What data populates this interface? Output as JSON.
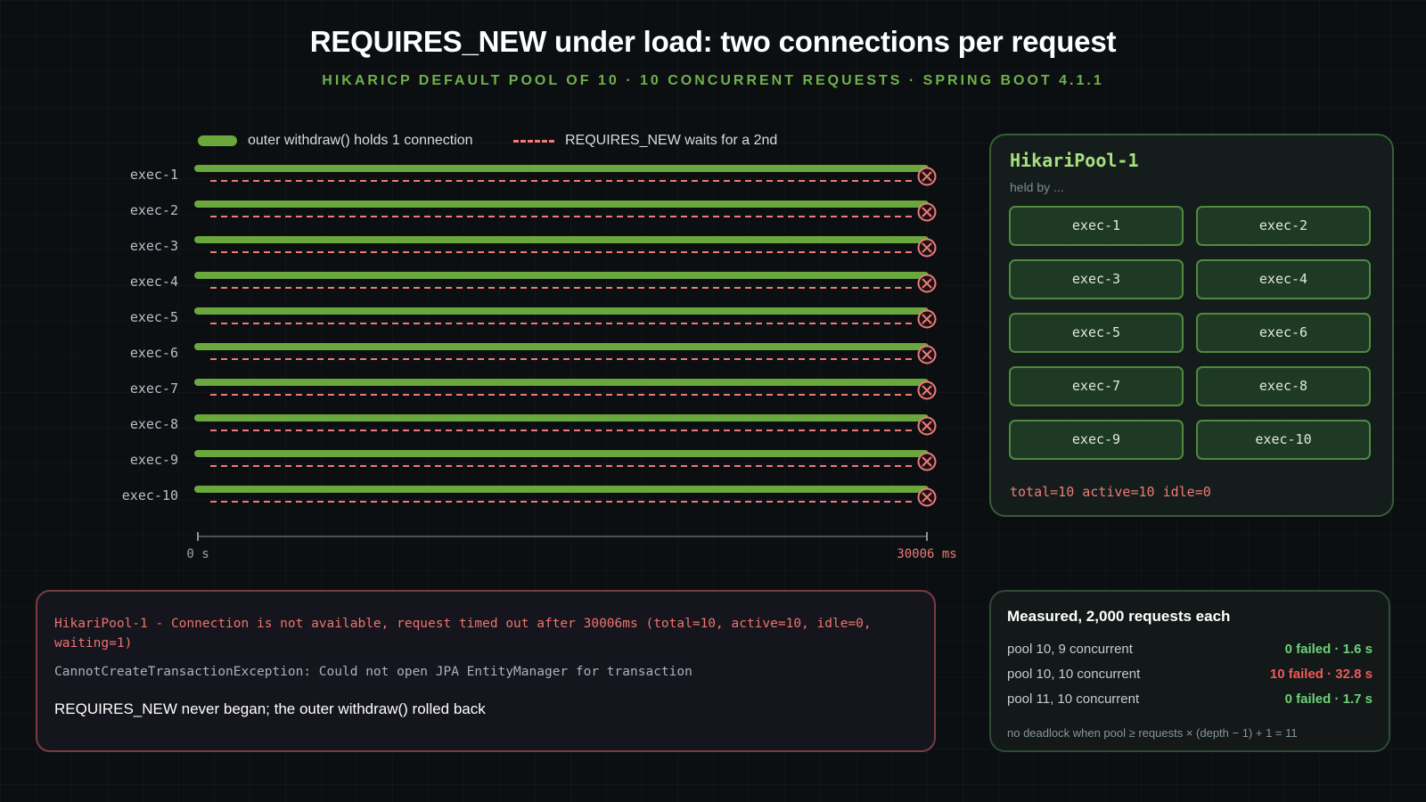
{
  "title": "REQUIRES_NEW under load: two connections per request",
  "subtitle": "HIKARICP DEFAULT POOL OF 10 · 10 CONCURRENT REQUESTS · SPRING BOOT 4.1.1",
  "legend": {
    "outer": "outer withdraw() holds 1 connection",
    "inner": "REQUIRES_NEW waits for a 2nd"
  },
  "timeline": {
    "rows": [
      "exec-1",
      "exec-2",
      "exec-3",
      "exec-4",
      "exec-5",
      "exec-6",
      "exec-7",
      "exec-8",
      "exec-9",
      "exec-10"
    ],
    "axis_start": "0 s",
    "axis_end": "30006 ms",
    "outcome_icon": "x-circle-icon"
  },
  "pool": {
    "name": "HikariPool-1",
    "held_by": "held by ...",
    "slots": [
      "exec-1",
      "exec-2",
      "exec-3",
      "exec-4",
      "exec-5",
      "exec-6",
      "exec-7",
      "exec-8",
      "exec-9",
      "exec-10"
    ],
    "stats": "total=10 active=10 idle=0"
  },
  "error": {
    "line1": "HikariPool-1 - Connection is not available, request timed out after 30006ms (total=10, active=10, idle=0, waiting=1)",
    "line2": "CannotCreateTransactionException: Could not open JPA EntityManager for transaction",
    "line3": "REQUIRES_NEW never began; the outer withdraw() rolled back"
  },
  "measured": {
    "title": "Measured, 2,000 requests each",
    "rows": [
      {
        "label": "pool 10, 9 concurrent",
        "value": "0 failed · 1.6 s",
        "status": "ok"
      },
      {
        "label": "pool 10, 10 concurrent",
        "value": "10 failed · 32.8 s",
        "status": "fail"
      },
      {
        "label": "pool 11, 10 concurrent",
        "value": "0 failed · 1.7 s",
        "status": "ok"
      }
    ],
    "note": "no deadlock when pool ≥ requests × (depth − 1) + 1 = 11"
  },
  "colors": {
    "outer_bar": "#6aa83e",
    "inner_dash": "#f07a78",
    "ok": "#6fd07a",
    "fail": "#f0595a",
    "axis_end": "#ef7a76"
  }
}
